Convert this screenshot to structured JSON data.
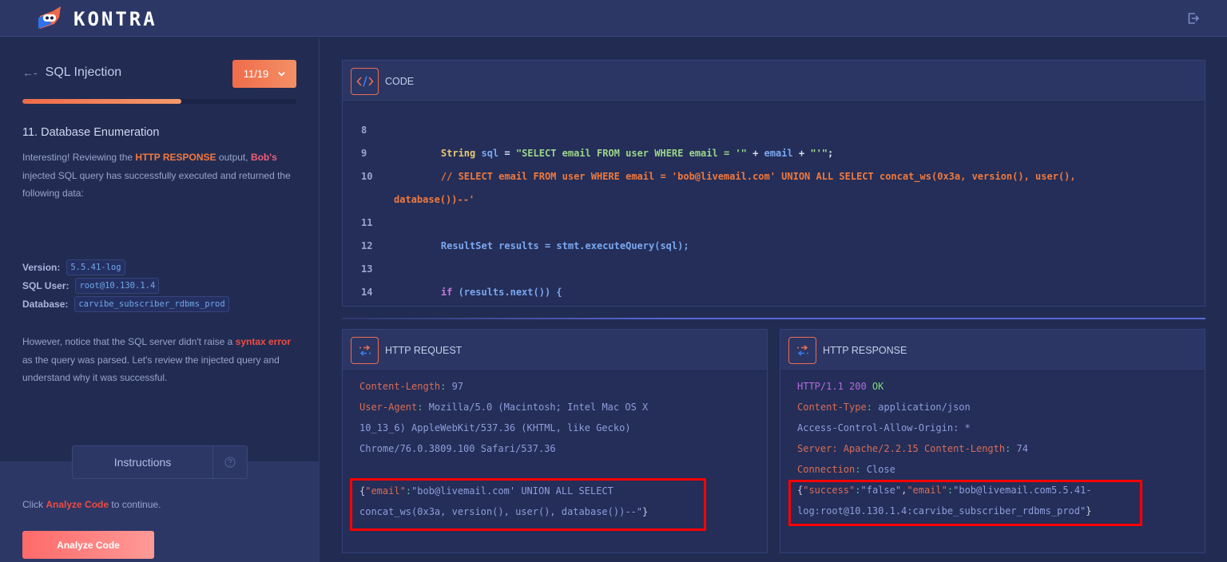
{
  "app": {
    "brand": "KONTRA",
    "logout_icon": "exit-icon"
  },
  "sidebar": {
    "back_icon": "back-arrow-icon",
    "lesson_title": "SQL Injection",
    "step_counter": "11/19",
    "progress_fraction": 0.579,
    "step_title": "11. Database Enumeration",
    "intro": {
      "t1": "Interesting! Reviewing the ",
      "h1": "HTTP RESPONSE",
      "t2": " output, ",
      "h2": "Bob's",
      "t3": " injected SQL query has successfully executed and returned the following data:"
    },
    "details": [
      {
        "label": "Version:",
        "value": "5.5.41-log"
      },
      {
        "label": "SQL User:",
        "value": "root@10.130.1.4"
      },
      {
        "label": "Database:",
        "value": "carvibe_subscriber_rdbms_prod"
      }
    ],
    "outro": {
      "t1": "However, notice that the SQL server didn't raise a ",
      "h1": "syntax error",
      "t2": " as the query was parsed. Let's review the injected query and understand why it was successful."
    },
    "instructions_tab": "Instructions",
    "help_icon": "question-circle-icon",
    "click_text": {
      "t1": "Click ",
      "h1": "Analyze Code",
      "t2": " to continue."
    },
    "analyze_button": "Analyze Code"
  },
  "code_panel": {
    "title": "CODE",
    "icon": "code-brackets-icon",
    "lines": [
      {
        "num": "8",
        "text": ""
      },
      {
        "num": "9",
        "parts": [
          "String",
          " sql",
          " = ",
          "\"SELECT email FROM user WHERE email = '\"",
          " + ",
          "email",
          " + ",
          "\"'\"",
          ";"
        ]
      },
      {
        "num": "10",
        "text": "// SELECT email FROM user WHERE email = 'bob@livemail.com' UNION ALL SELECT concat_ws(0x3a, version(), user(),",
        "cont": "database())--'"
      },
      {
        "num": "11",
        "text": ""
      },
      {
        "num": "12",
        "text": "ResultSet results = stmt.executeQuery(sql);"
      },
      {
        "num": "13",
        "text": ""
      },
      {
        "num": "14",
        "parts": [
          "if",
          " (results.next()) {"
        ]
      }
    ]
  },
  "request_panel": {
    "title": "HTTP REQUEST",
    "icon": "exchange-arrows-icon",
    "lines": [
      {
        "key": "Content-Length",
        "value": " 97"
      },
      {
        "key": "User-Agent",
        "value": " Mozilla/5.0 (Macintosh; Intel Mac OS X"
      },
      {
        "text": "10_13_6) AppleWebKit/537.36 (KHTML, like Gecko)"
      },
      {
        "text": "Chrome/76.0.3809.100 Safari/537.36"
      }
    ],
    "body": {
      "key": "\"email\"",
      "line1_value": "\"bob@livemail.com' UNION ALL SELECT",
      "line2_value": "concat_ws(0x3a, version(), user(), database())--\""
    }
  },
  "response_panel": {
    "title": "HTTP RESPONSE",
    "icon": "exchange-arrows-icon",
    "status": {
      "proto": "HTTP/1.1 200",
      "ok": " OK"
    },
    "lines": [
      {
        "key": "Content-Type",
        "value": " application/json"
      },
      {
        "text": "Access-Control-Allow-Origin: *"
      },
      {
        "key_plain": "Server: Apache/2.2.15 Content-Length",
        "value": " 74"
      },
      {
        "key": "Connection",
        "value": " Close"
      }
    ],
    "body": {
      "k1": "\"success\"",
      "v1": "\"false\"",
      "k2": "\"email\"",
      "v2_line1": "\"bob@livemail.com5.5.41-",
      "v2_line2": "log:root@10.130.1.4:carvibe_subscriber_rdbms_prod\""
    }
  },
  "colors": {
    "accent": "#f07a52",
    "highlight_box": "#ff0000",
    "background": "#222c52"
  }
}
